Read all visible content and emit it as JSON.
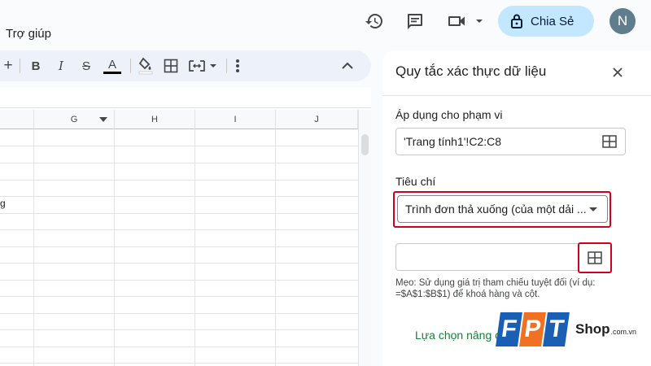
{
  "menubar": {
    "help": "Trợ giúp"
  },
  "header": {
    "share_label": "Chia Sẻ",
    "avatar_initial": "N"
  },
  "toolbar": {
    "plus": "+",
    "bold": "B",
    "italic": "I",
    "strikethrough": "S",
    "text_color_letter": "A",
    "text_color": "#000000"
  },
  "grid": {
    "columns": [
      "G",
      "H",
      "I",
      "J"
    ],
    "partial_cell_text": "g"
  },
  "panel": {
    "title": "Quy tắc xác thực dữ liệu",
    "range_label": "Áp dụng cho phạm vi",
    "range_value": "'Trang tính1'!C2:C8",
    "criteria_label": "Tiêu chí",
    "criteria_value": "Trình đơn thả xuống (của một dải ...",
    "tip": "Mẹo: Sử dụng giá trị tham chiếu tuyệt đối (ví dụ: =$A$1:$B$1) để khoá hàng và cột.",
    "advanced_link": "Lựa chọn nâng c"
  },
  "watermark": {
    "letters": [
      "F",
      "P",
      "T"
    ],
    "shop": "Shop",
    "domain": ".com.vn"
  },
  "colors": {
    "highlight": "#d0021b",
    "share_bg": "#c2e7ff",
    "link": "#188038"
  }
}
